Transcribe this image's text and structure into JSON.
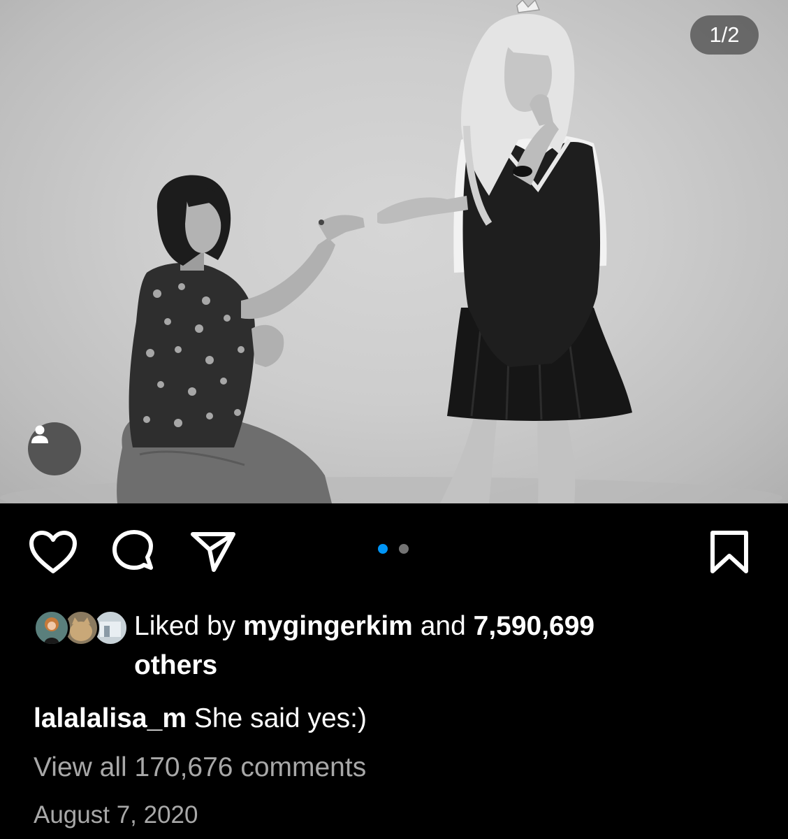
{
  "post": {
    "page_counter": "1/2",
    "carousel": {
      "count": 2,
      "active_index": 0,
      "active_color": "#0095f6",
      "inactive_color": "#737373"
    },
    "actions": {
      "like_icon": "heart-icon",
      "comment_icon": "comment-bubble-icon",
      "share_icon": "paper-plane-icon",
      "save_icon": "bookmark-icon",
      "tag_icon": "person-icon"
    },
    "likes": {
      "prefix": "Liked by",
      "user": "mygingerkim",
      "joiner": "and",
      "count": "7,590,699",
      "suffix": "others"
    },
    "caption": {
      "username": "lalalalisa_m",
      "text": "She said yes:)"
    },
    "view_comments": "View all 170,676 comments",
    "date": "August 7, 2020"
  },
  "colors": {
    "background": "#000000",
    "text": "#ffffff",
    "secondary_text": "#a8a8a8",
    "accent": "#0095f6"
  }
}
